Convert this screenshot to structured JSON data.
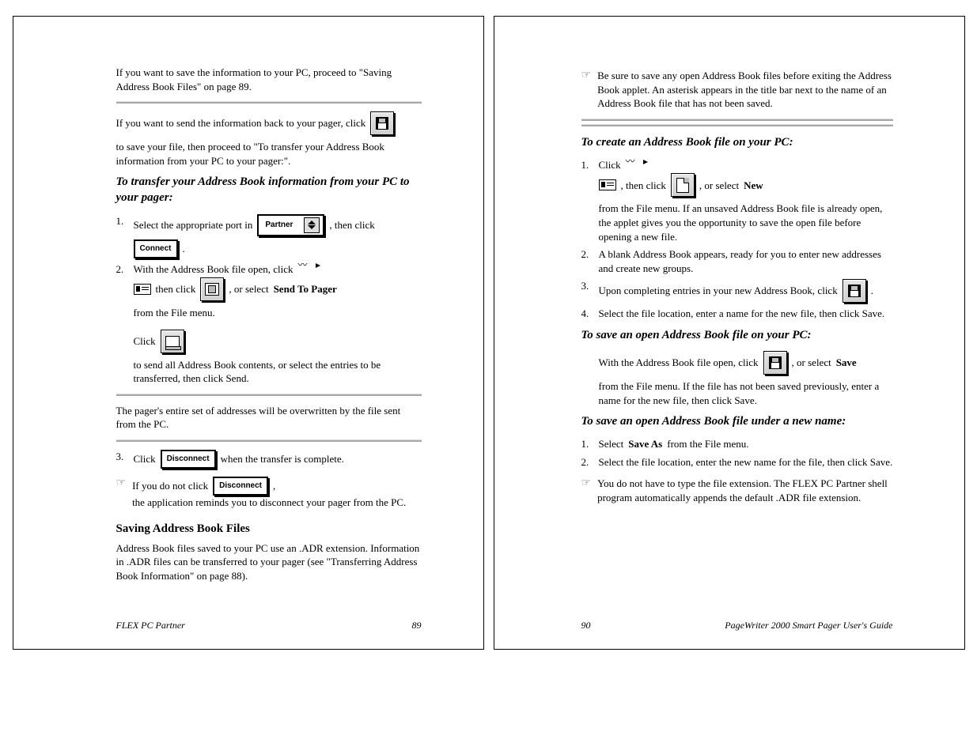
{
  "left": {
    "intro_a": "If you want to save the information to your PC, proceed to \"Saving Address Book Files\" on page 89.",
    "intro_b1": "If you want to send the information back to your pager, click",
    "intro_b2": "to save your file, then proceed to \"To transfer your Address Book information from your PC to your pager:\".",
    "heading1": "To transfer your Address Book information from your PC to your pager:",
    "step1a": "1.",
    "step1b": "Select the appropriate port in",
    "step1c": ", then click",
    "step1d": ".",
    "step2a": "2.",
    "step2b": "With the Address Book file open, click",
    "step2c": "then click",
    "step2d": ", or select",
    "step2e": "Send To Pager",
    "step2f": "from the File menu.",
    "step3a": "Click",
    "step3b": "to send all Address Book contents, or select the entries to be transferred, then click Send.",
    "note_a": "The pager's entire set of addresses will be overwritten by the file sent from the PC.",
    "step3c": "3.",
    "step3d": "Click",
    "step3e": "when the transfer is complete.",
    "note_b1": "If you do not click",
    "note_b2": ",",
    "note_b_cont": "the application reminds you to disconnect your pager from the PC.",
    "heading_bottom": "Saving Address Book Files",
    "body_bottom": "Address Book files saved to your PC use an .ADR extension. Information in .ADR files can be transferred to your pager (see \"Transferring Address Book Information\" on page 88).",
    "footer_left": "FLEX PC Partner",
    "footer_right": "89",
    "dropdown_label": "Partner",
    "btn_connect": "Connect",
    "btn_disconnect": "Disconnect"
  },
  "right": {
    "note_top": "Be sure to save any open Address Book files before exiting the Address Book applet. An asterisk appears in the title bar next to the name of an Address Book file that has not been saved.",
    "heading1": "To create an Address Book file on your PC:",
    "step1a": "1.",
    "step1b": "Click",
    "step1c": ", then click",
    "step1d": ", or select",
    "step1e": "New",
    "step1f": "from the File menu. If an unsaved Address Book file is already open, the applet gives you the opportunity to save the open file before opening a new file.",
    "step2a": "2.",
    "step2b1": "A blank Address Book appears, ready for you to enter new addresses and create new groups.",
    "step3a": "3.",
    "step3b": "Upon completing entries in your new Address Book, click",
    "step3c": ".",
    "step4a": "4.",
    "step4b": "Select the file location, enter a name for the new file, then click Save.",
    "heading2": "To save an open Address Book file on your PC:",
    "s2_step1a": "With the Address Book file open, click",
    "s2_step1b": ", or select",
    "s2_step1c": "Save",
    "s2_step1d": "from the File menu. If the file has not been saved previously, enter a name for the new file, then click Save.",
    "heading3": "To save an open Address Book file under a new name:",
    "s3_step1a": "1.",
    "s3_step1b": "Select",
    "s3_step1c": "Save As",
    "s3_step1d": "from the File menu.",
    "s3_step2a": "2.",
    "s3_step2b": "Select the file location, enter the new name for the file, then click Save.",
    "note_bottom": "You do not have to type the file extension. The FLEX PC Partner shell program automatically appends the default .ADR file extension.",
    "footer_left": "90",
    "footer_right": "PageWriter 2000 Smart Pager User's Guide"
  }
}
